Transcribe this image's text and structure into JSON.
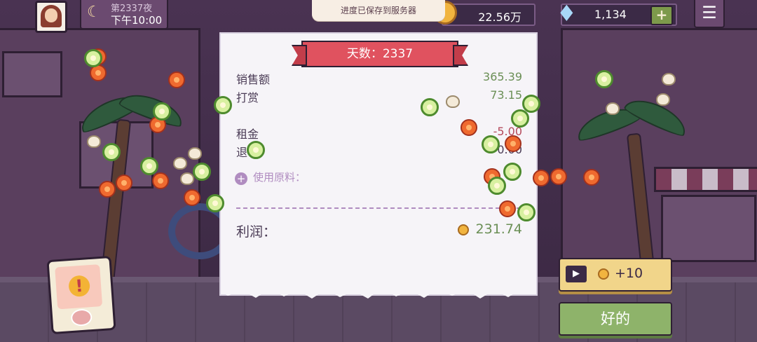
{
  "hud": {
    "day_label": "第2337夜",
    "time_label": "下午10:00",
    "toast": "进度已保存到服务器",
    "coins": "22.56万",
    "gems": "1,134",
    "gem_plus": "+",
    "menu_icon": "☰"
  },
  "receipt": {
    "banner": "天数：2337",
    "rows": [
      {
        "label": "销售额",
        "value": "365.39"
      },
      {
        "label": "打赏",
        "value": "73.15"
      },
      {
        "label": "租金",
        "value": "-5.00"
      },
      {
        "label": "退",
        "value": "0.00"
      }
    ],
    "materials_label": "使用原料：",
    "profit_label": "利润：",
    "profit_value": "231.74"
  },
  "buttons": {
    "ad_reward": "+10",
    "ok": "好的",
    "play_icon": "▶"
  },
  "icons": {
    "moon": "☾",
    "gem": "♦",
    "alert": "!"
  },
  "colors": {
    "banner": "#e0525f",
    "ok_button": "#8eb36a",
    "ad_button": "#f1d58a",
    "positive": "#6b8f56",
    "negative": "#b54a5c"
  }
}
